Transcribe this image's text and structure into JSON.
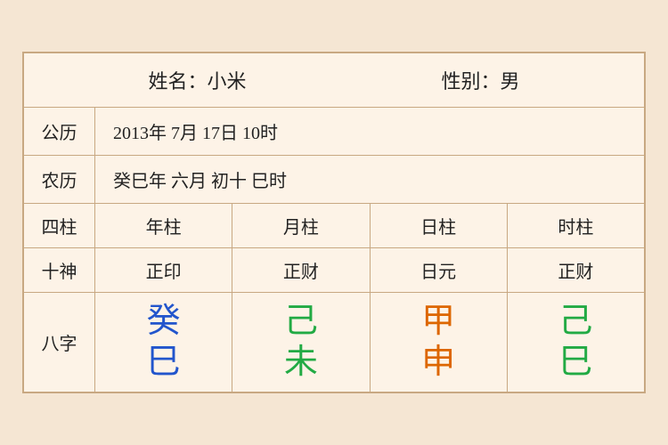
{
  "header": {
    "name_label": "姓名：小米",
    "gender_label": "性别：男"
  },
  "rows": [
    {
      "label": "公历",
      "value": "2013年 7月 17日 10时"
    },
    {
      "label": "农历",
      "value": "癸巳年 六月 初十 巳时"
    }
  ],
  "grid_headers": {
    "row_label": "四柱",
    "cols": [
      "年柱",
      "月柱",
      "日柱",
      "时柱"
    ]
  },
  "shishen": {
    "row_label": "十神",
    "cols": [
      "正印",
      "正财",
      "日元",
      "正财"
    ]
  },
  "bazi": {
    "row_label": "八字",
    "cols": [
      {
        "top": "癸",
        "bottom": "巳",
        "top_color": "color-blue",
        "bottom_color": "color-blue"
      },
      {
        "top": "己",
        "bottom": "未",
        "top_color": "color-green",
        "bottom_color": "color-green"
      },
      {
        "top": "甲",
        "bottom": "申",
        "top_color": "color-orange",
        "bottom_color": "color-orange"
      },
      {
        "top": "己",
        "bottom": "巳",
        "top_color": "color-green2",
        "bottom_color": "color-green2"
      }
    ]
  }
}
